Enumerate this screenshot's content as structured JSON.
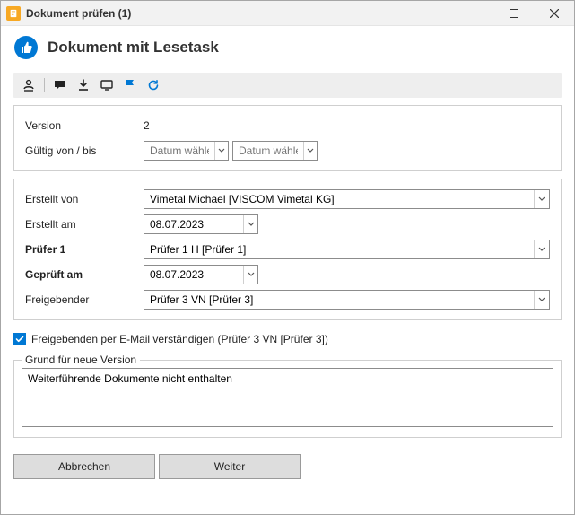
{
  "titlebar": {
    "title": "Dokument prüfen (1)"
  },
  "header": {
    "title": "Dokument mit Lesetask"
  },
  "toolbar": {
    "items": [
      {
        "name": "globe-icon"
      },
      {
        "name": "comment-icon"
      },
      {
        "name": "download-icon"
      },
      {
        "name": "monitor-icon"
      },
      {
        "name": "flag-icon"
      },
      {
        "name": "refresh-icon"
      }
    ]
  },
  "section1": {
    "version_label": "Version",
    "version_value": "2",
    "valid_label": "Gültig von / bis",
    "date_placeholder": "Datum wählen"
  },
  "section2": {
    "created_by_label": "Erstellt von",
    "created_by_value": "Vimetal Michael [VISCOM Vimetal KG]",
    "created_on_label": "Erstellt am",
    "created_on_value": "08.07.2023",
    "pruefer_label": "Prüfer 1",
    "pruefer_value": "Prüfer 1 H [Prüfer 1]",
    "geprueft_label": "Geprüft am",
    "geprueft_value": "08.07.2023",
    "freigebender_label": "Freigebender",
    "freigebender_value": "Prüfer 3 VN [Prüfer 3]"
  },
  "notify": {
    "label": "Freigebenden per E-Mail verständigen (Prüfer 3 VN [Prüfer 3])",
    "checked": true
  },
  "reason": {
    "legend": "Grund für neue Version",
    "value": "Weiterführende Dokumente nicht enthalten"
  },
  "buttons": {
    "cancel": "Abbrechen",
    "next": "Weiter"
  }
}
